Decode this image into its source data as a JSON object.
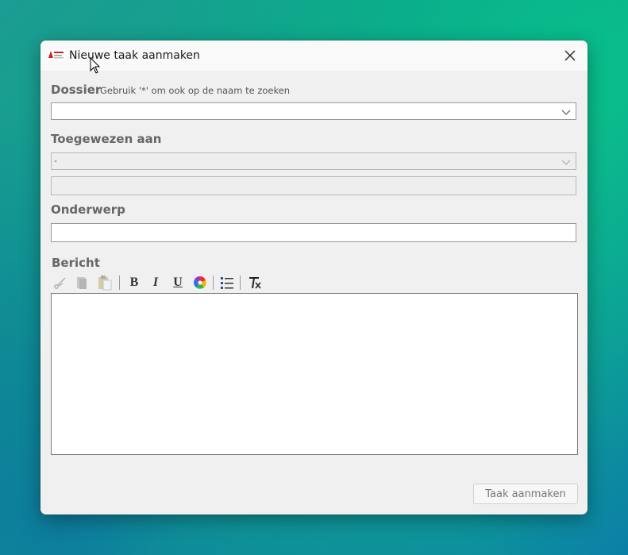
{
  "window": {
    "title": "Nieuwe taak aanmaken",
    "app_icon": "app-logo-icon"
  },
  "form": {
    "dossier": {
      "label": "Dossier",
      "hint": "Gebruik '*' om ook op de naam te zoeken",
      "value": ""
    },
    "assigned": {
      "label": "Toegewezen aan",
      "value": "-",
      "secondary_value": ""
    },
    "subject": {
      "label": "Onderwerp",
      "value": ""
    },
    "message": {
      "label": "Bericht",
      "toolbar": [
        "scissors-icon",
        "copy-icon",
        "paste-icon",
        "bold-icon",
        "italic-icon",
        "underline-icon",
        "color-wheel-icon",
        "bullet-list-icon",
        "clear-format-icon"
      ],
      "bold_glyph": "B",
      "italic_glyph": "I",
      "underline_glyph": "U"
    },
    "submit_label": "Taak aanmaken"
  },
  "colors": {
    "dialog_bg": "#f0f0f0",
    "label": "#666666",
    "disabled_text": "#777777"
  }
}
